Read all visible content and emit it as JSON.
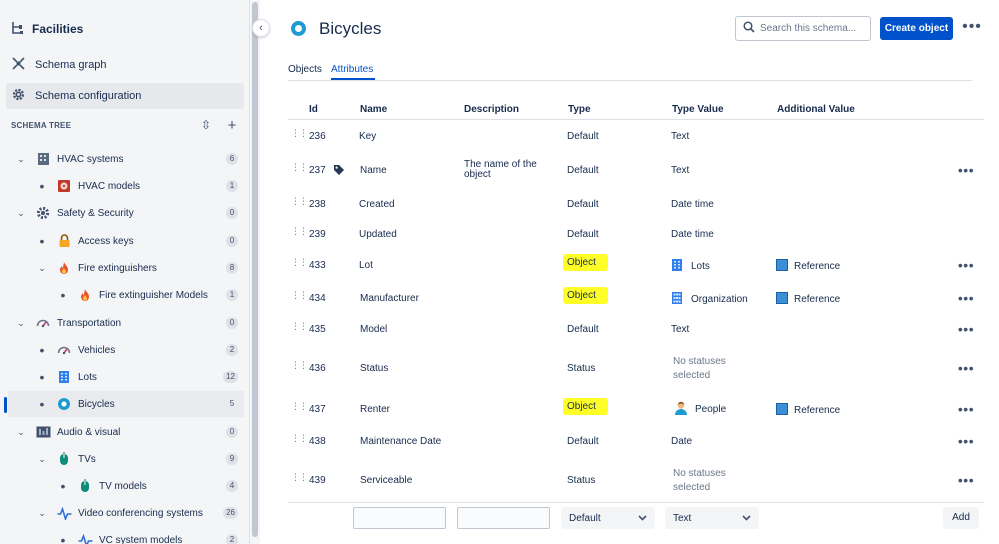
{
  "sidebar": {
    "title": "Facilities",
    "links": [
      {
        "label": "Schema graph"
      },
      {
        "label": "Schema configuration"
      }
    ],
    "schema_tree_label": "SCHEMA TREE",
    "tree": [
      {
        "label": "HVAC systems",
        "count": "6"
      },
      {
        "label": "HVAC models",
        "count": "1"
      },
      {
        "label": "Safety & Security",
        "count": "0"
      },
      {
        "label": "Access keys",
        "count": "0"
      },
      {
        "label": "Fire extinguishers",
        "count": "8"
      },
      {
        "label": "Fire extinguisher Models",
        "count": "1"
      },
      {
        "label": "Transportation",
        "count": "0"
      },
      {
        "label": "Vehicles",
        "count": "2"
      },
      {
        "label": "Lots",
        "count": "12"
      },
      {
        "label": "Bicycles",
        "count": "5"
      },
      {
        "label": "Audio & visual",
        "count": "0"
      },
      {
        "label": "TVs",
        "count": "9"
      },
      {
        "label": "TV models",
        "count": "4"
      },
      {
        "label": "Video conferencing systems",
        "count": "26"
      },
      {
        "label": "VC system models",
        "count": "2"
      }
    ]
  },
  "header": {
    "title": "Bicycles",
    "search_placeholder": "Search this schema...",
    "create_label": "Create object"
  },
  "tabs": [
    {
      "label": "Objects",
      "active": false
    },
    {
      "label": "Attributes",
      "active": true
    }
  ],
  "table": {
    "columns": [
      "Id",
      "Name",
      "Description",
      "Type",
      "Type Value",
      "Additional Value"
    ],
    "rows": [
      {
        "id": "236",
        "name": "Key",
        "description": "",
        "type": "Default",
        "type_value": "Text",
        "additional": ""
      },
      {
        "id": "237",
        "name": "Name",
        "description_l1": "The name of the",
        "description_l2": "object",
        "type": "Default",
        "type_value": "Text",
        "additional": "",
        "label_icon": true
      },
      {
        "id": "238",
        "name": "Created",
        "description": "",
        "type": "Default",
        "type_value": "Date time",
        "additional": ""
      },
      {
        "id": "239",
        "name": "Updated",
        "description": "",
        "type": "Default",
        "type_value": "Date time",
        "additional": ""
      },
      {
        "id": "433",
        "name": "Lot",
        "description": "",
        "type": "Object",
        "type_value": "Lots",
        "additional": "Reference",
        "highlighted": true
      },
      {
        "id": "434",
        "name": "Manufacturer",
        "description": "",
        "type": "Object",
        "type_value": "Organization",
        "additional": "Reference",
        "highlighted": true
      },
      {
        "id": "435",
        "name": "Model",
        "description": "",
        "type": "Default",
        "type_value": "Text",
        "additional": ""
      },
      {
        "id": "436",
        "name": "Status",
        "description": "",
        "type": "Status",
        "type_value_l1": "No statuses",
        "type_value_l2": "selected",
        "additional": ""
      },
      {
        "id": "437",
        "name": "Renter",
        "description": "",
        "type": "Object",
        "type_value": "People",
        "additional": "Reference",
        "highlighted": true
      },
      {
        "id": "438",
        "name": "Maintenance Date",
        "description": "",
        "type": "Default",
        "type_value": "Date",
        "additional": ""
      },
      {
        "id": "439",
        "name": "Serviceable",
        "description": "",
        "type": "Status",
        "type_value_l1": "No statuses",
        "type_value_l2": "selected",
        "additional": ""
      }
    ],
    "new_row": {
      "type_select": "Default",
      "type_value_select": "Text",
      "add_label": "Add"
    }
  },
  "colors": {
    "accent": "#0052cc",
    "highlight": "#ffff27",
    "reference_square": "#3b8fd9"
  }
}
